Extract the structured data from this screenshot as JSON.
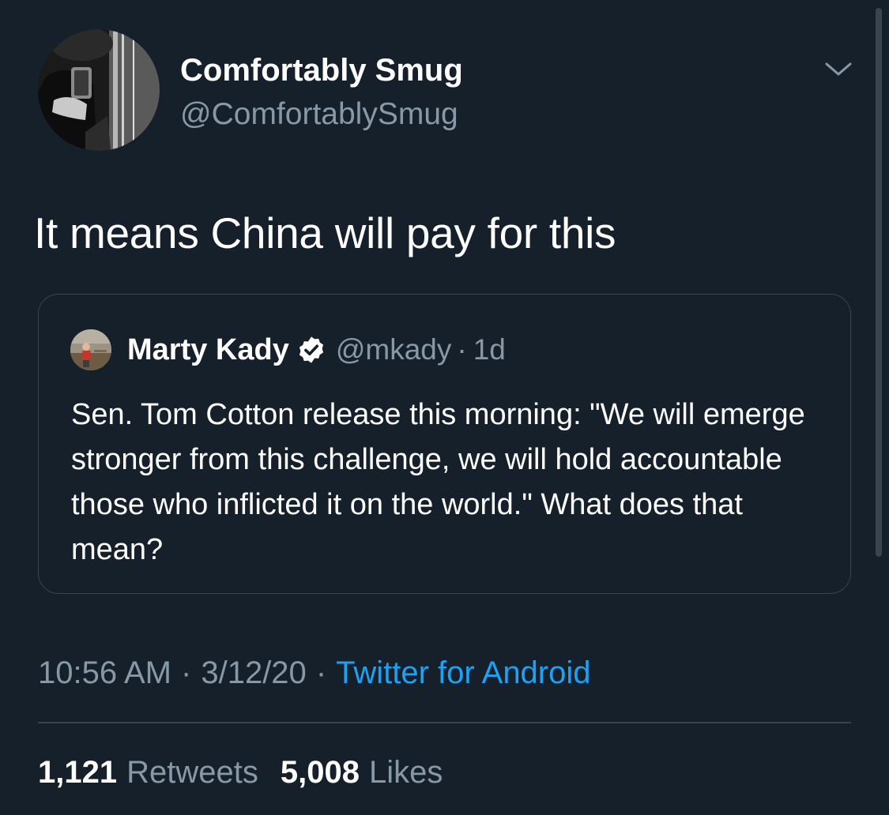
{
  "tweet": {
    "author": {
      "display_name": "Comfortably Smug",
      "handle": "@ComfortablySmug"
    },
    "text": "It means China will pay for this",
    "more_icon": "chevron-down-icon",
    "quoted_tweet": {
      "author_name": "Marty Kady",
      "verified": true,
      "verified_icon": "verified-badge-icon",
      "handle": "@mkady",
      "separator": "·",
      "time": "1d",
      "text": "Sen. Tom Cotton release this morning: \"We will emerge stronger from this challenge, we will hold accountable those who inflicted it on the world.\" What does that mean?"
    },
    "meta": {
      "time": "10:56 AM",
      "date": "3/12/20",
      "separator": "·",
      "source": "Twitter for Android"
    },
    "stats": {
      "retweets_count": "1,121",
      "retweets_label": "Retweets",
      "likes_count": "5,008",
      "likes_label": "Likes"
    }
  },
  "colors": {
    "background": "#15202b",
    "primary_text": "#ffffff",
    "secondary_text": "#8899a6",
    "link": "#1da1f2",
    "border": "#38444d"
  }
}
